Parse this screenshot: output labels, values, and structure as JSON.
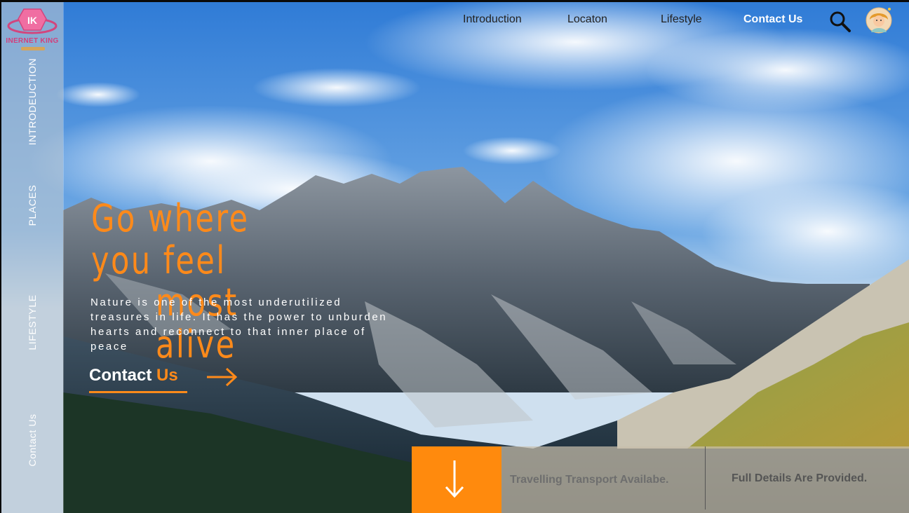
{
  "brand": {
    "logo_text": "INERNET KING",
    "logo_initials": "IK"
  },
  "sidebar": {
    "items": [
      {
        "label": "INTRODEUCTION"
      },
      {
        "label": "PLACES"
      },
      {
        "label": "LIFESTYLE"
      },
      {
        "label": "Contact Us"
      }
    ]
  },
  "nav": {
    "items": [
      {
        "label": "Introduction"
      },
      {
        "label": "Locaton"
      },
      {
        "label": "Lifestyle"
      },
      {
        "label": "Contact Us"
      }
    ],
    "active_index": 3,
    "icons": {
      "search": "search-icon",
      "avatar": "user-avatar"
    }
  },
  "hero": {
    "headline_line1": "Go where you feel",
    "headline_line2": "most alive",
    "description": "Nature is one of the most underutilized treasures in life. It has the power to unburden hearts and reconnect to that inner place of peace",
    "cta_main": "Contact",
    "cta_accent": "Us"
  },
  "bottom_bar": {
    "info_1": "Travelling Transport Availabe.",
    "info_2": "Full Details Are Provided."
  },
  "colors": {
    "accent": "#ff8a1a",
    "sidebar": "#b9c6d2",
    "text_dark": "#222222"
  }
}
